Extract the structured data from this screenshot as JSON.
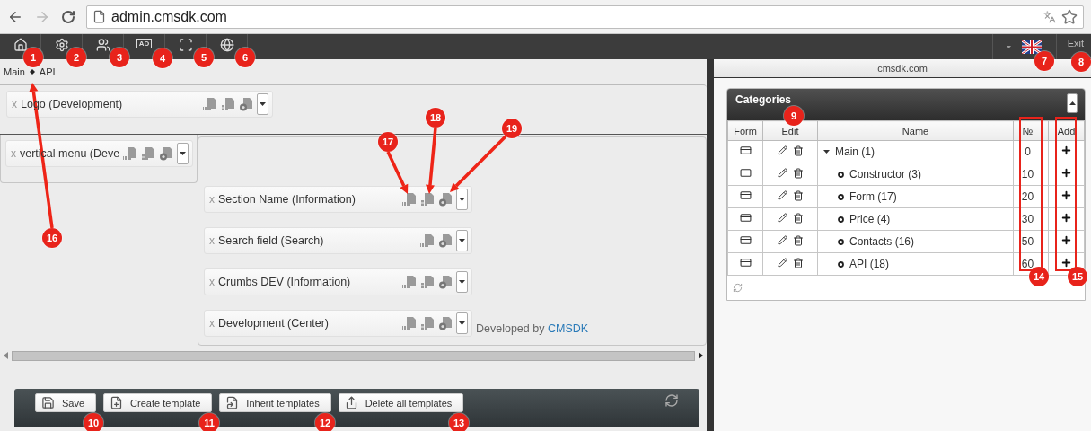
{
  "browser": {
    "url": "admin.cmsdk.com"
  },
  "toolbar": {
    "tools": [
      {
        "kind": "home"
      },
      {
        "kind": "settings"
      },
      {
        "kind": "users"
      },
      {
        "kind": "ad",
        "label": "AD"
      },
      {
        "kind": "frame"
      },
      {
        "kind": "globe"
      }
    ],
    "exit": "Exit"
  },
  "breadcrumbs": [
    "Main",
    "API"
  ],
  "top_blocks": [
    {
      "label": "Logo (Development)",
      "remove": "x",
      "layout": true
    }
  ],
  "side_blocks": [
    {
      "label": "vertical menu (Deve",
      "remove": "x",
      "layout": true
    }
  ],
  "content_blocks": [
    {
      "label": "Section Name (Information)",
      "remove": "x",
      "layout": true
    },
    {
      "label": "Search field (Search)",
      "remove": "x",
      "layout": false
    },
    {
      "label": "Crumbs DEV (Information)",
      "remove": "x",
      "layout": true
    },
    {
      "label": "Development (Center)",
      "remove": "x",
      "layout": true
    }
  ],
  "credit": {
    "text": "Developed by",
    "link": "CMSDK"
  },
  "actions": [
    {
      "kind": "save",
      "label": "Save"
    },
    {
      "kind": "create",
      "label": "Create template"
    },
    {
      "kind": "inherit",
      "label": "Inherit templates"
    },
    {
      "kind": "delete",
      "label": "Delete all templates"
    }
  ],
  "site": "cmsdk.com",
  "categories": {
    "title": "Categories",
    "columns": [
      "Form",
      "Edit",
      "Name",
      "№",
      "Add"
    ],
    "rows": [
      {
        "name": "Main (1)",
        "order": "0",
        "expanded": true,
        "children": [
          {
            "name": "Constructor (3)",
            "order": "10"
          },
          {
            "name": "Form (17)",
            "order": "20"
          },
          {
            "name": "Price (4)",
            "order": "30"
          },
          {
            "name": "Contacts (16)",
            "order": "50"
          },
          {
            "name": "API (18)",
            "order": "60"
          }
        ]
      }
    ]
  },
  "annotations": [
    "1",
    "2",
    "3",
    "4",
    "5",
    "6",
    "7",
    "8",
    "9",
    "10",
    "11",
    "12",
    "13",
    "14",
    "15",
    "16",
    "17",
    "18",
    "19"
  ]
}
